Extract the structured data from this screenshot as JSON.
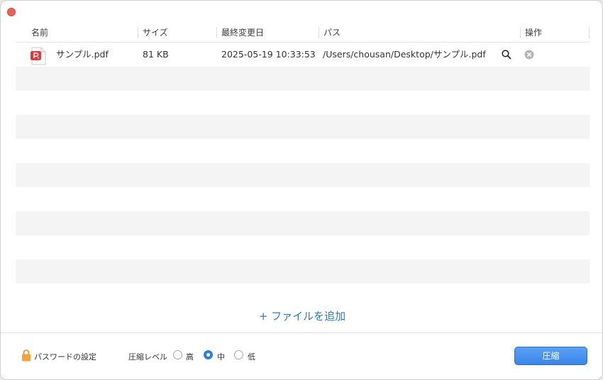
{
  "table": {
    "headers": {
      "name": "名前",
      "size": "サイズ",
      "modified": "最終変更日",
      "path": "パス",
      "actions": "操作"
    },
    "files": [
      {
        "name": "サンプル.pdf",
        "size": "81 KB",
        "modified": "2025-05-19 10:33:53",
        "path": "/Users/chousan/Desktop/サンプル.pdf",
        "icon": "pdf-file-icon"
      }
    ]
  },
  "add_files_label": "+ ファイルを追加",
  "footer": {
    "password_label": "パスワードの設定",
    "level_label": "圧縮レベル",
    "levels": [
      {
        "label": "高",
        "selected": false
      },
      {
        "label": "中",
        "selected": true
      },
      {
        "label": "低",
        "selected": false
      }
    ],
    "compress_button": "圧縮"
  },
  "colors": {
    "accent": "#2a7de1",
    "close": "#ee5f57",
    "pdf_red": "#e8323c",
    "lock": "#f2a33a"
  }
}
